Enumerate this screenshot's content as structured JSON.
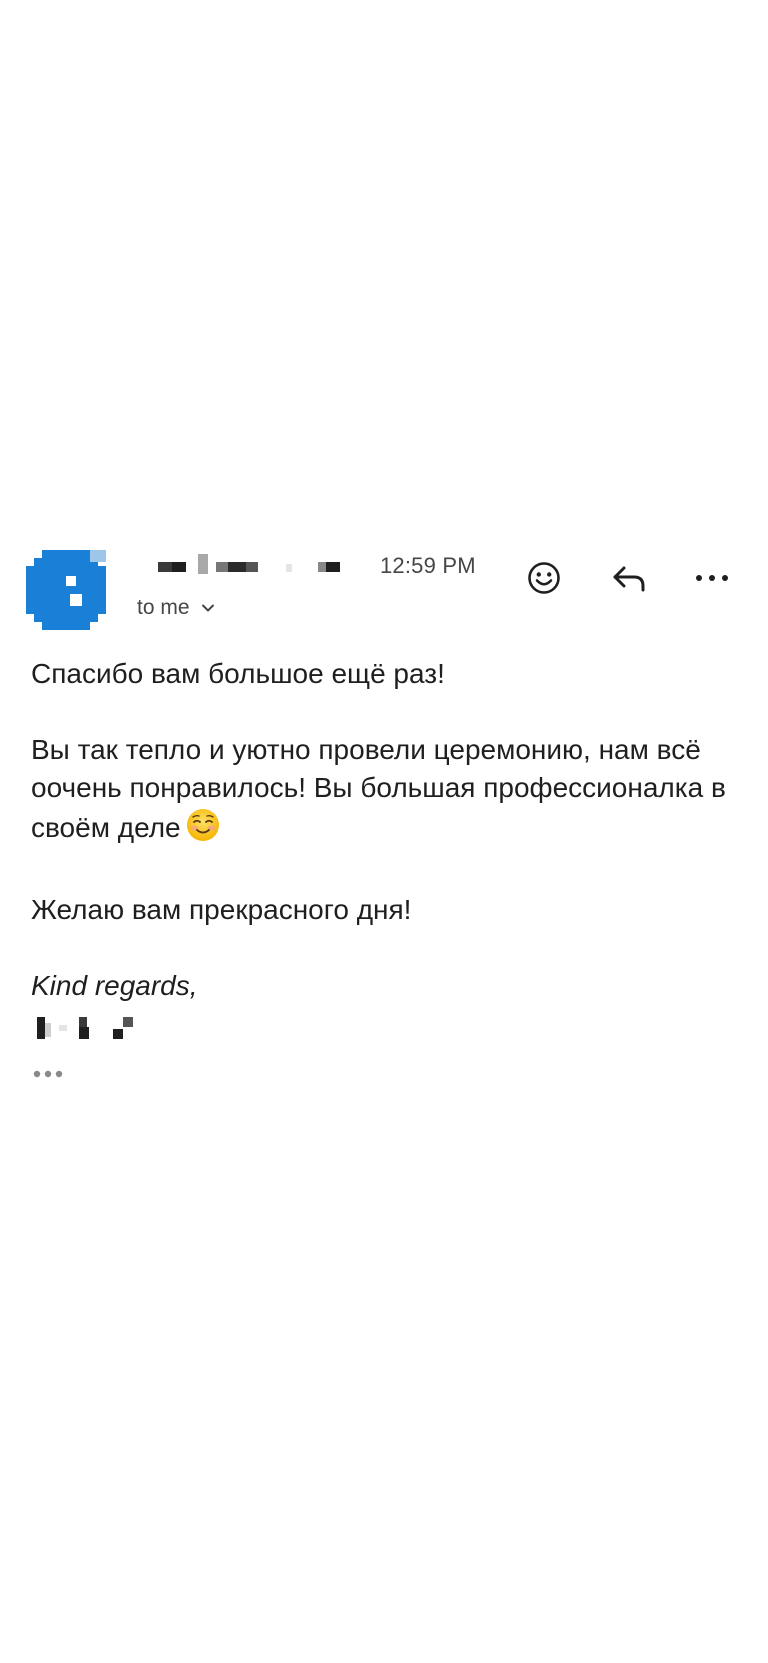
{
  "header": {
    "time": "12:59 PM",
    "recipient_label": "to me",
    "avatar_color": "#1a7fd6",
    "icons": {
      "react": "smiley-icon",
      "reply": "reply-arrow-icon",
      "more": "more-dots-icon",
      "chevron": "chevron-down-icon"
    }
  },
  "message": {
    "greeting": "Спасибо вам большое ещё раз!",
    "paragraph": "Вы так тепло и уютно провели церемонию, нам всё оочень понравилось! Вы большая профессионалка в своём деле",
    "paragraph_emoji": "smiling-face-icon",
    "wish": "Желаю вам прекрасного дня!",
    "signoff": "Kind regards,"
  },
  "trimmed_content_icon": "ellipsis-icon"
}
